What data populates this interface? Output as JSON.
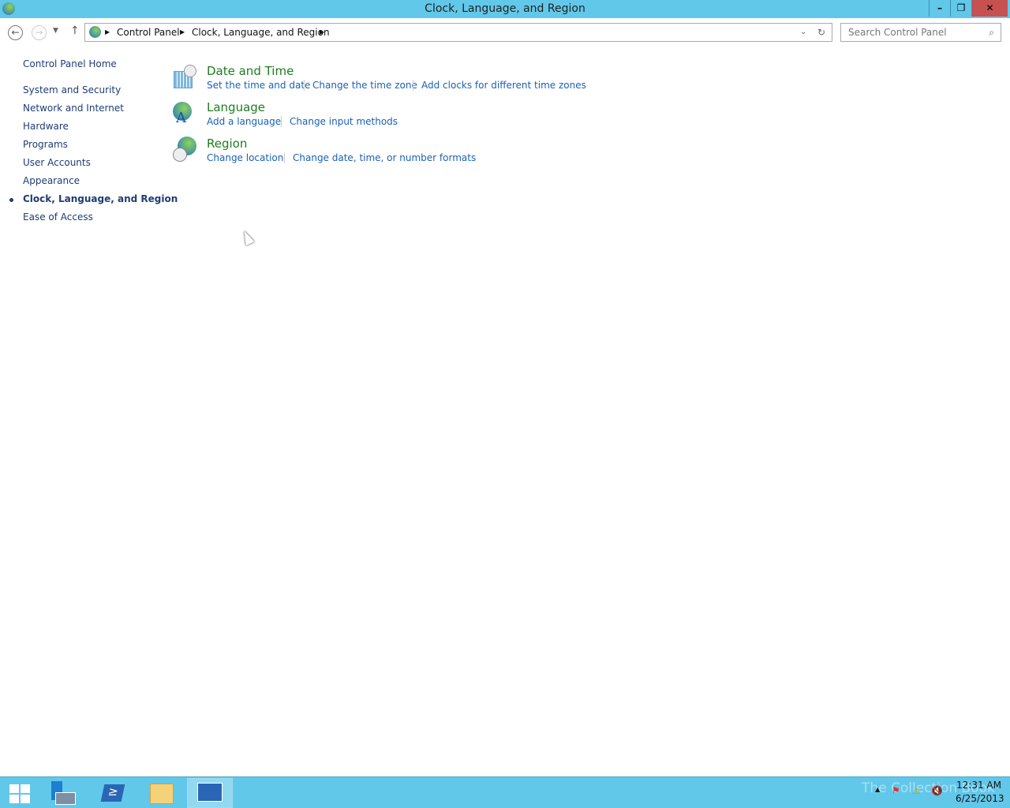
{
  "window": {
    "title": "Clock, Language, and Region",
    "minimize": "–",
    "restore": "❐",
    "close": "✕"
  },
  "nav": {
    "breadcrumb": [
      "Control Panel",
      "Clock, Language, and Region"
    ],
    "search_placeholder": "Search Control Panel"
  },
  "sidebar": {
    "items": [
      {
        "label": "Control Panel Home"
      },
      {
        "label": "System and Security"
      },
      {
        "label": "Network and Internet"
      },
      {
        "label": "Hardware"
      },
      {
        "label": "Programs"
      },
      {
        "label": "User Accounts"
      },
      {
        "label": "Appearance"
      },
      {
        "label": "Clock, Language, and Region",
        "current": true
      },
      {
        "label": "Ease of Access"
      }
    ]
  },
  "categories": [
    {
      "title": "Date and Time",
      "icon": "calendar-clock-icon",
      "links": [
        "Set the time and date",
        "Change the time zone",
        "Add clocks for different time zones"
      ]
    },
    {
      "title": "Language",
      "icon": "language-globe-icon",
      "links": [
        "Add a language",
        "Change input methods"
      ]
    },
    {
      "title": "Region",
      "icon": "region-globe-clock-icon",
      "links": [
        "Change location",
        "Change date, time, or number formats"
      ]
    }
  ],
  "taskbar": {
    "apps": [
      "start-icon",
      "server-manager-icon",
      "powershell-icon",
      "file-explorer-icon",
      "control-panel-icon"
    ],
    "time": "12:31 AM",
    "date": "6/25/2013",
    "watermark": "The Collection Book"
  },
  "colors": {
    "titlebar": "#62c8ea",
    "close": "#c75050",
    "category": "#1e7d1e",
    "link": "#1a61b6"
  }
}
